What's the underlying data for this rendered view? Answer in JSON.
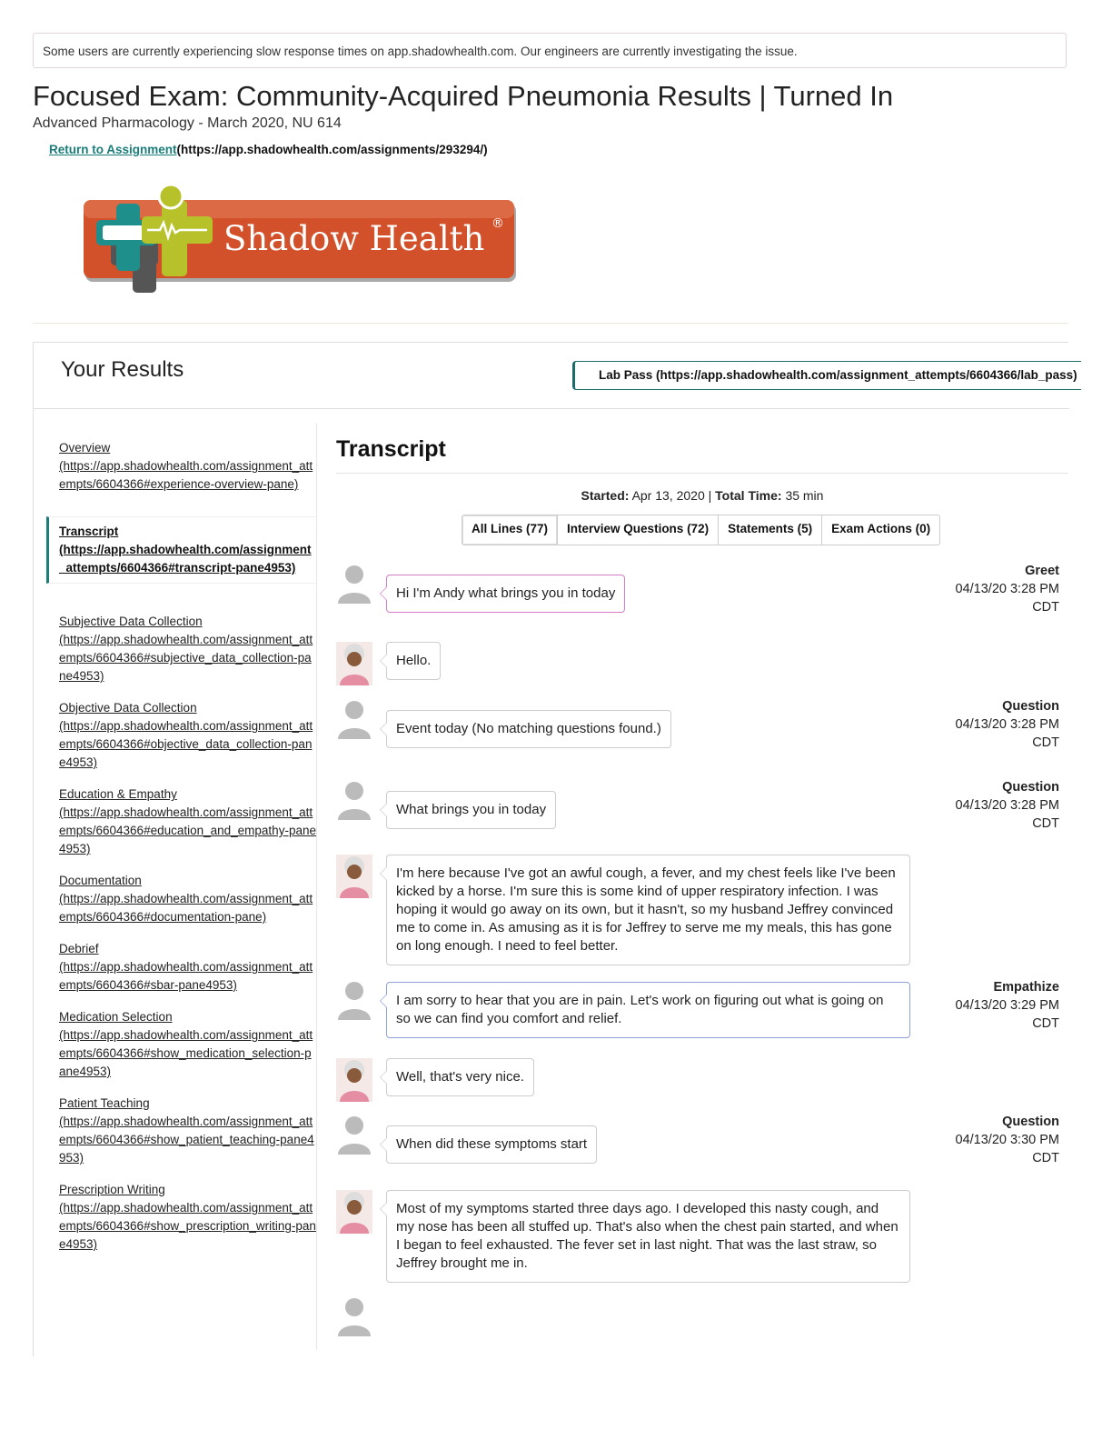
{
  "banner": "Some users are currently experiencing slow response times on app.shadowhealth.com. Our engineers are currently investigating the issue.",
  "page": {
    "title": "Focused Exam: Community-Acquired Pneumonia Results | Turned In",
    "subtitle": "Advanced Pharmacology - March 2020, NU 614",
    "return_label": "Return to Assignment",
    "return_url": "(https://app.shadowhealth.com/assignments/293294/)"
  },
  "logo": {
    "text": "Shadow Health",
    "mark": "®",
    "colors": {
      "orange": "#d2502a",
      "teal": "#1f8f8c",
      "lime": "#b7c22a",
      "gray": "#555555"
    }
  },
  "results": {
    "title": "Your Results",
    "lab_pass": "Lab Pass (https://app.shadowhealth.com/assignment_attempts/6604366/lab_pass)"
  },
  "sidebar": {
    "items": [
      {
        "label": "Overview",
        "url": "(https://app.shadowhealth.com/assignment_attempts/6604366#experience-overview-pane)"
      },
      {
        "label": "Transcript",
        "url": "(https://app.shadowhealth.com/assignment_attempts/6604366#transcript-pane4953)"
      },
      {
        "label": "Subjective Data Collection",
        "url": "(https://app.shadowhealth.com/assignment_attempts/6604366#subjective_data_collection-pane4953)"
      },
      {
        "label": "Objective Data Collection",
        "url": "(https://app.shadowhealth.com/assignment_attempts/6604366#objective_data_collection-pane4953)"
      },
      {
        "label": "Education & Empathy",
        "url": "(https://app.shadowhealth.com/assignment_attempts/6604366#education_and_empathy-pane4953)"
      },
      {
        "label": "Documentation",
        "url": "(https://app.shadowhealth.com/assignment_attempts/6604366#documentation-pane)"
      },
      {
        "label": "Debrief",
        "url": "(https://app.shadowhealth.com/assignment_attempts/6604366#sbar-pane4953)"
      },
      {
        "label": "Medication Selection",
        "url": "(https://app.shadowhealth.com/assignment_attempts/6604366#show_medication_selection-pane4953)"
      },
      {
        "label": "Patient Teaching",
        "url": "(https://app.shadowhealth.com/assignment_attempts/6604366#show_patient_teaching-pane4953)"
      },
      {
        "label": "Prescription Writing",
        "url": "(https://app.shadowhealth.com/assignment_attempts/6604366#show_prescription_writing-pane4953)"
      }
    ]
  },
  "transcript": {
    "title": "Transcript",
    "started_label": "Started:",
    "started_value": "Apr 13, 2020",
    "sep": "|",
    "total_label": "Total Time:",
    "total_value": "35 min",
    "tabs": [
      "All Lines (77)",
      "Interview Questions (72)",
      "Statements (5)",
      "Exam Actions (0)"
    ],
    "messages": [
      {
        "speaker": "student",
        "text": "Hi I'm Andy what brings you in today",
        "kind": "Greet",
        "time": "04/13/20 3:28 PM",
        "tz": "CDT"
      },
      {
        "speaker": "patient",
        "text": "Hello."
      },
      {
        "speaker": "student",
        "text": "Event today (No matching questions found.)",
        "kind": "Question",
        "time": "04/13/20 3:28 PM",
        "tz": "CDT"
      },
      {
        "speaker": "student",
        "text": "What brings you in today",
        "kind": "Question",
        "time": "04/13/20 3:28 PM",
        "tz": "CDT"
      },
      {
        "speaker": "patient",
        "text": "I'm here because I've got an awful cough, a fever, and my chest feels like I've been kicked by a horse. I'm sure this is some kind of upper respiratory infection. I was hoping it would go away on its own, but it hasn't, so my husband Jeffrey convinced me to come in. As amusing as it is for Jeffrey to serve me my meals, this has gone on long enough. I need to feel better."
      },
      {
        "speaker": "student",
        "text": "I am sorry to hear that you are in pain. Let's work on figuring out what is going on so we can find you comfort and relief.",
        "kind": "Empathize",
        "time": "04/13/20 3:29 PM",
        "tz": "CDT"
      },
      {
        "speaker": "patient",
        "text": "Well, that's very nice."
      },
      {
        "speaker": "student",
        "text": "When did these symptoms start",
        "kind": "Question",
        "time": "04/13/20 3:30 PM",
        "tz": "CDT"
      },
      {
        "speaker": "patient",
        "text": "Most of my symptoms started three days ago. I developed this nasty cough, and my nose has been all stuffed up. That's also when the chest pain started, and when I began to feel exhausted. The fever set in last night. That was the last straw, so Jeffrey brought me in."
      }
    ]
  }
}
